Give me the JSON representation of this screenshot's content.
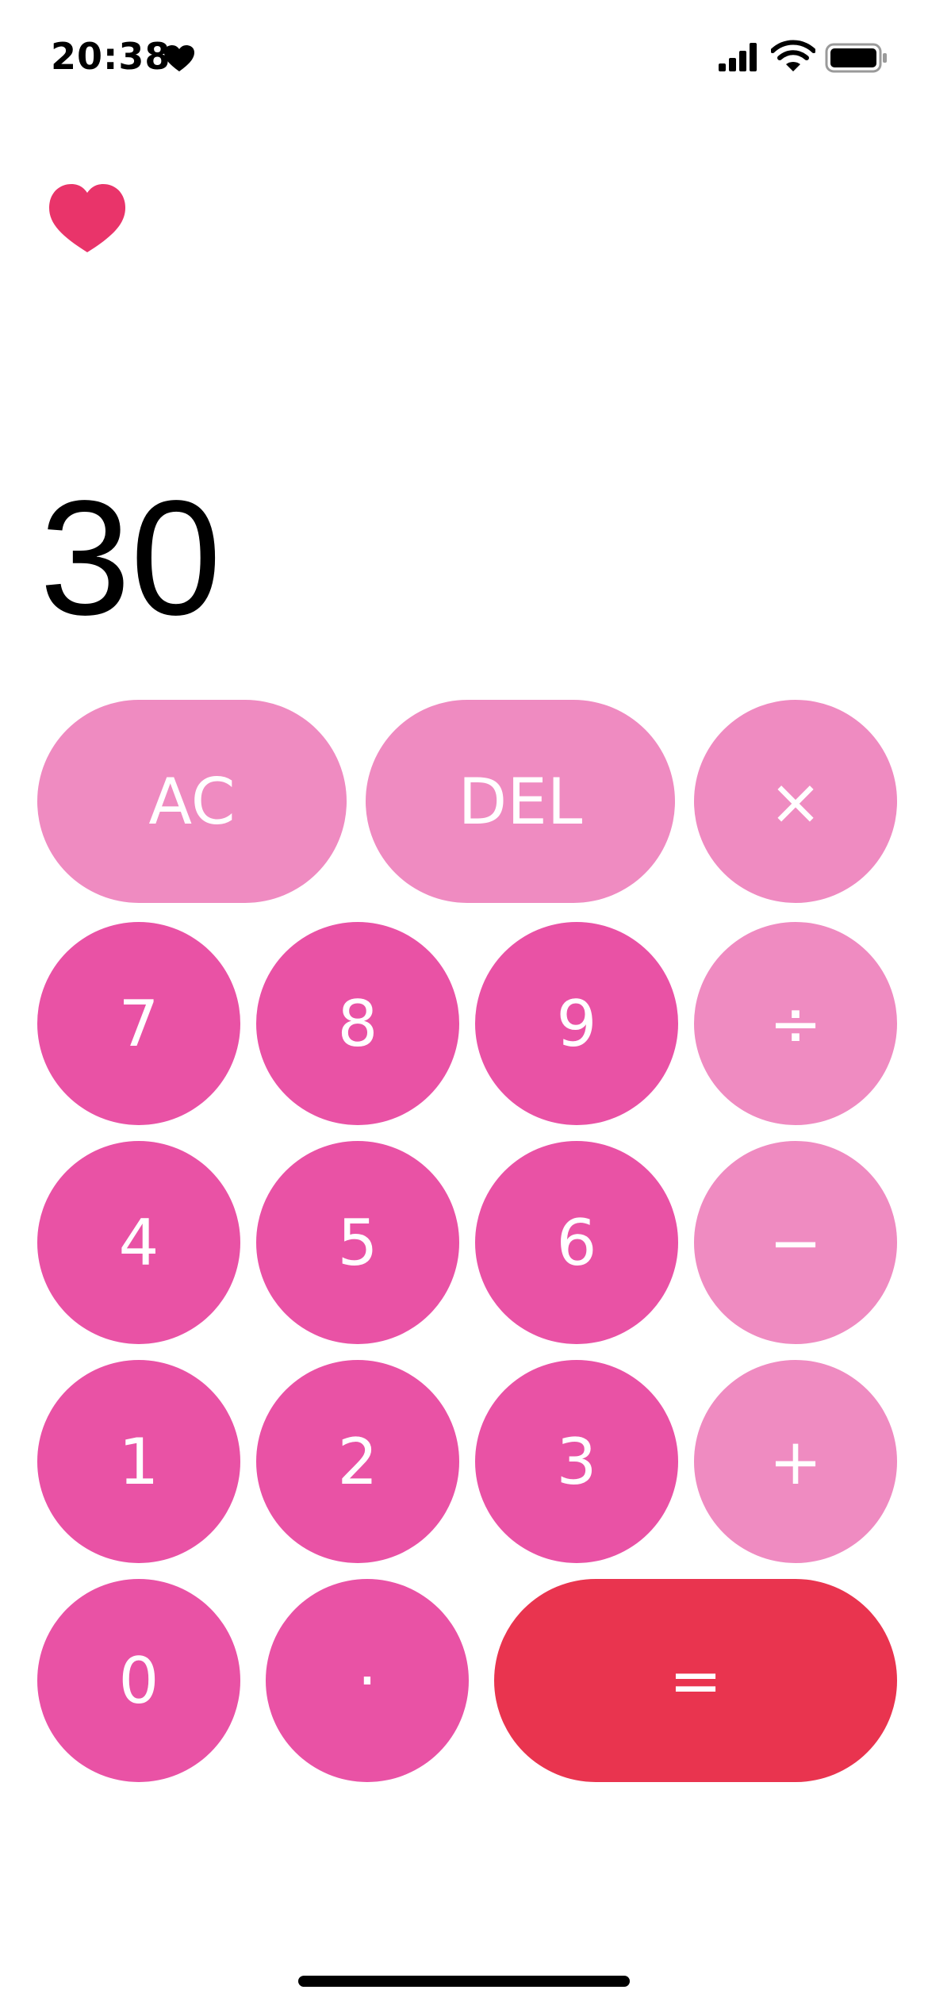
{
  "status_bar": {
    "time": "20:38",
    "icons": [
      "heart-icon",
      "signal-icon",
      "wifi-icon",
      "battery-icon"
    ]
  },
  "app": {
    "logo_icon": "heart-icon",
    "accent_color": "#e9346a"
  },
  "display": {
    "value": "30"
  },
  "keys": {
    "ac": "AC",
    "del": "DEL",
    "multiply": "×",
    "divide": "÷",
    "subtract": "−",
    "add": "+",
    "equals": "=",
    "decimal": "·",
    "digits": {
      "0": "0",
      "1": "1",
      "2": "2",
      "3": "3",
      "4": "4",
      "5": "5",
      "6": "6",
      "7": "7",
      "8": "8",
      "9": "9"
    }
  },
  "colors": {
    "digit_key": "#e952a5",
    "operator_key": "#ef8bc1",
    "equals_key": "#e9344f",
    "key_text": "#ffffff",
    "background": "#ffffff"
  }
}
